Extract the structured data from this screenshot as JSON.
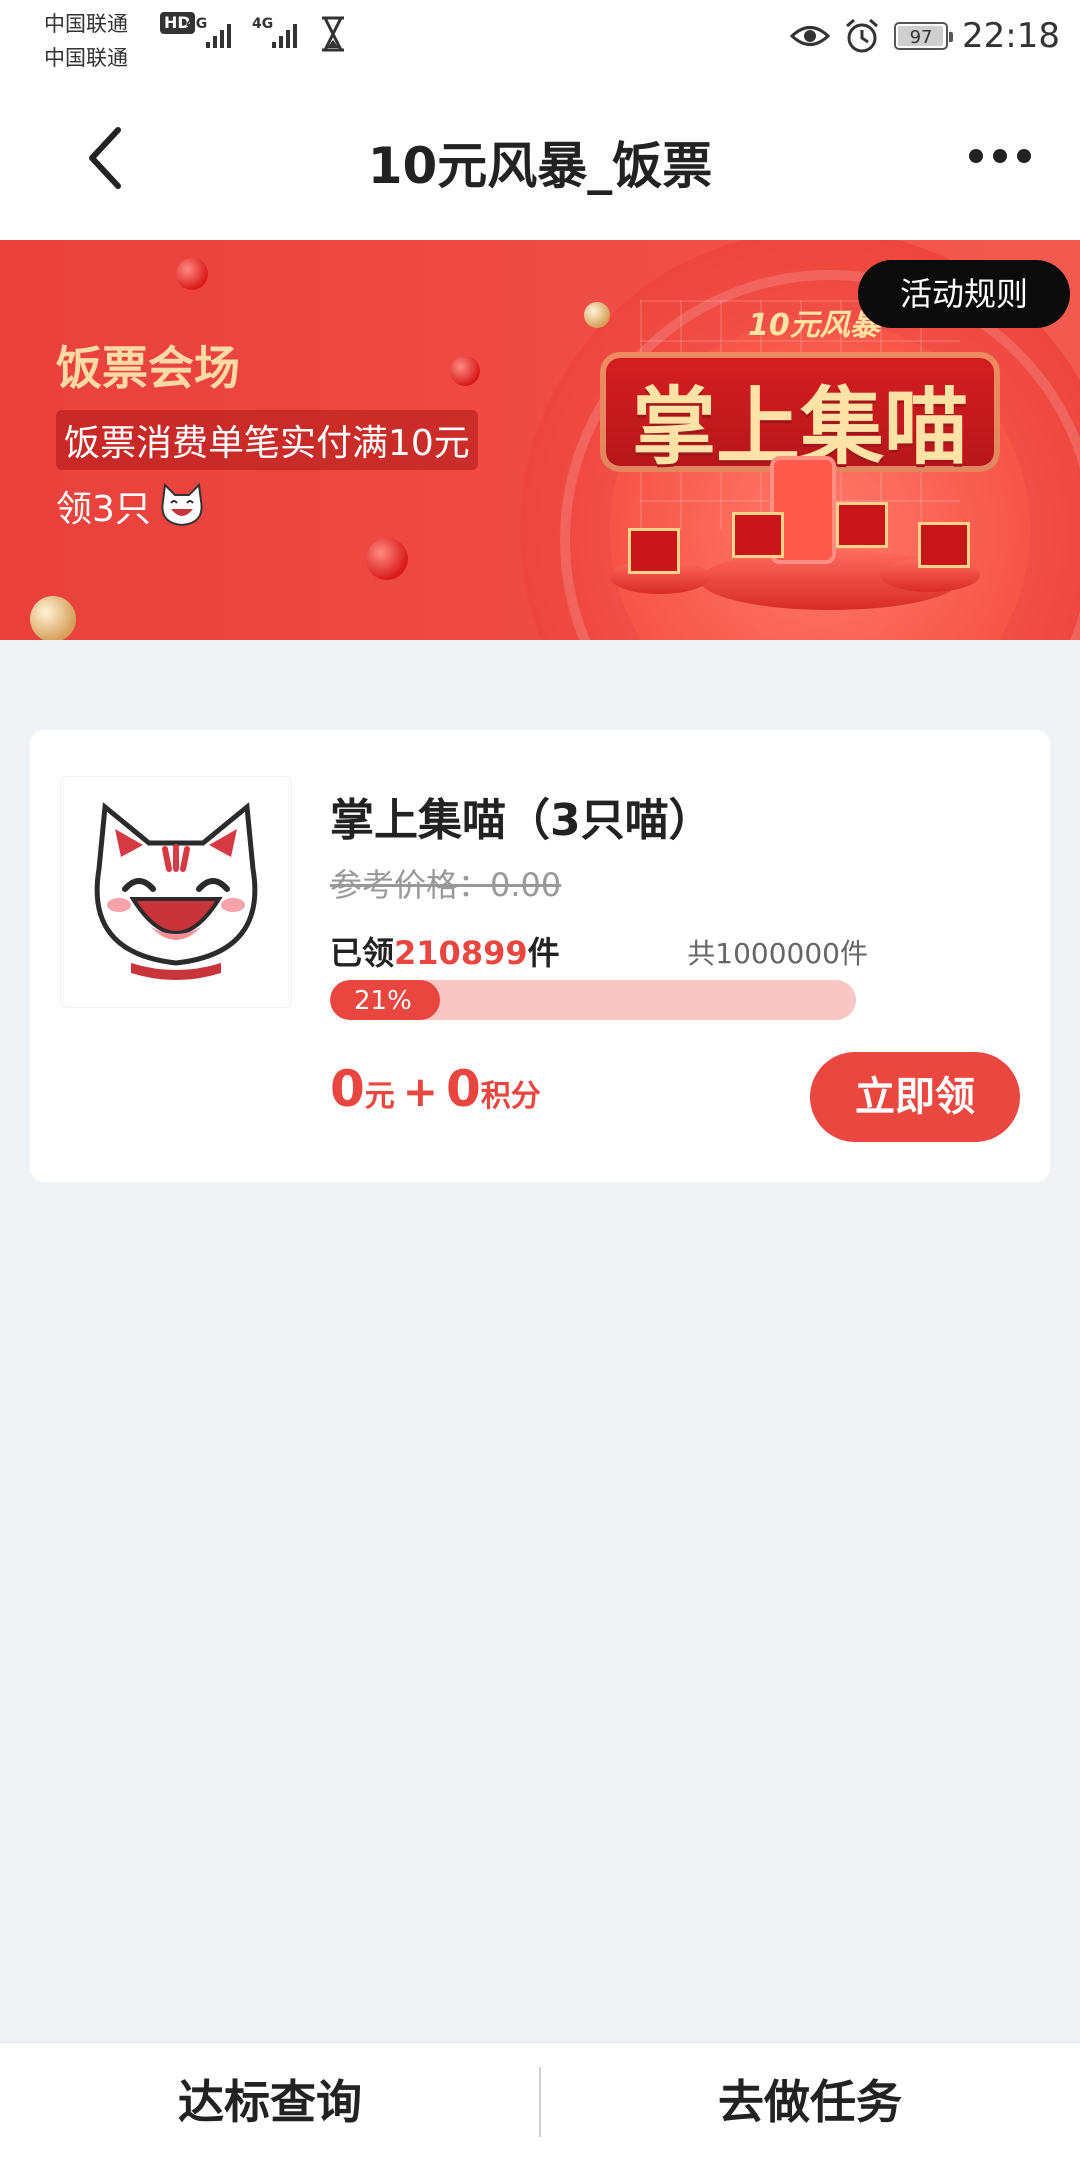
{
  "status_bar": {
    "carrier_1": "中国联通",
    "carrier_2": "中国联通",
    "hd_badge": "HD",
    "network_1": "4G",
    "network_2": "4G",
    "battery": "97",
    "time": "22:18"
  },
  "header": {
    "title": "10元风暴_饭票"
  },
  "banner": {
    "venue": "饭票会场",
    "condition": "饭票消费单笔实付满10元",
    "reward": "领3只",
    "brand_small": "10元风暴",
    "brand_big": "掌上集喵",
    "rules_label": "活动规则"
  },
  "product": {
    "name": "掌上集喵（3只喵）",
    "ref_price": "参考价格：0.00",
    "claimed_prefix": "已领",
    "claimed_count": "210899",
    "claimed_suffix": "件",
    "total": "共1000000件",
    "progress_percent": 21,
    "progress_label": "21%",
    "price_yuan": "0",
    "price_yuan_unit": "元",
    "price_plus": "+",
    "price_points": "0",
    "price_points_unit": "积分",
    "claim_button": "立即领"
  },
  "bottom_bar": {
    "left_label": "达标查询",
    "right_label": "去做任务"
  },
  "colors": {
    "accent": "#e8463f",
    "progress_track": "#f8c7c5",
    "banner_red": "#ee4a43",
    "background": "#f0f3f6"
  },
  "icons": [
    "back-arrow-icon",
    "more-dots-icon",
    "eye-icon",
    "alarm-icon",
    "hourglass-icon",
    "signal-icon",
    "cat-face-icon"
  ]
}
